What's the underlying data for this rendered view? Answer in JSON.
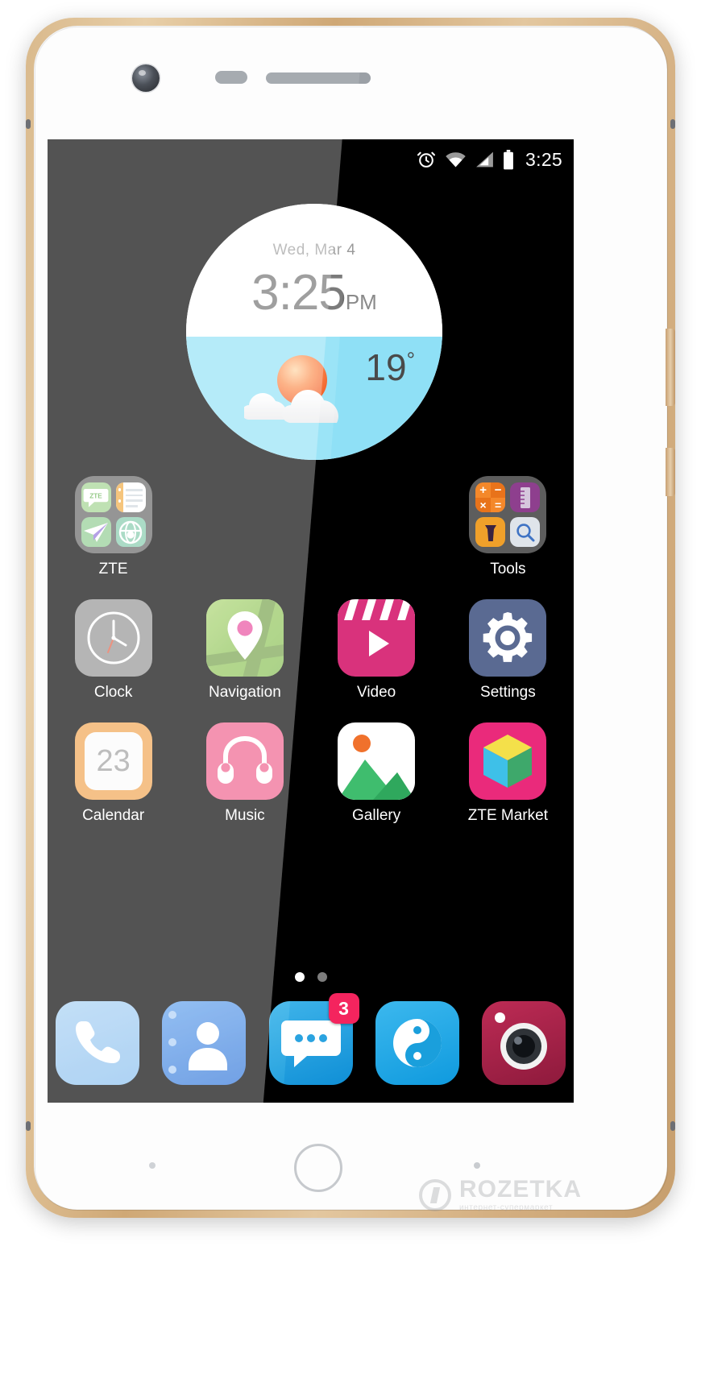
{
  "device": {
    "brand": "ZTE",
    "home_button": "home-button"
  },
  "status_bar": {
    "time": "3:25",
    "icons": [
      "alarm-icon",
      "wifi-icon",
      "signal-icon",
      "battery-icon"
    ]
  },
  "widget": {
    "name": "clock-weather-widget",
    "date": "Wed, Mar 4",
    "time": "3:25",
    "ampm": "PM",
    "temperature": "19",
    "degree": "°",
    "weather_icon": "sun-behind-cloud-icon",
    "refresh_icon": "refresh-icon",
    "sky_color": "#8fe0f6",
    "face_color": "#ffffff"
  },
  "home_screen": {
    "rows": [
      {
        "cells": [
          {
            "label": "ZTE",
            "type": "folder",
            "name": "folder-zte",
            "minis": [
              "zte-message-icon",
              "notes-icon",
              "paper-plane-icon",
              "browser-icon"
            ]
          },
          {
            "label": "",
            "type": "empty",
            "name": "empty-slot"
          },
          {
            "label": "",
            "type": "empty",
            "name": "empty-slot"
          },
          {
            "label": "Tools",
            "type": "folder",
            "name": "folder-tools",
            "minis": [
              "calculator-icon",
              "ruler-icon",
              "flashlight-icon",
              "search-icon"
            ]
          }
        ]
      },
      {
        "cells": [
          {
            "label": "Clock",
            "type": "app",
            "name": "app-clock",
            "icon": "clock-icon",
            "color": "#8c8c8c"
          },
          {
            "label": "Navigation",
            "type": "app",
            "name": "app-navigation",
            "icon": "map-pin-icon",
            "color": "#8dc63f"
          },
          {
            "label": "Video",
            "type": "app",
            "name": "app-video",
            "icon": "play-icon",
            "color": "#e0337f"
          },
          {
            "label": "Settings",
            "type": "app",
            "name": "app-settings",
            "icon": "gear-icon",
            "color": "#5a6a92"
          }
        ]
      },
      {
        "cells": [
          {
            "label": "Calendar",
            "type": "app",
            "name": "app-calendar",
            "icon": "calendar-icon",
            "color": "#f0a04b",
            "day": "23"
          },
          {
            "label": "Music",
            "type": "app",
            "name": "app-music",
            "icon": "earbuds-icon",
            "color": "#ef5b87"
          },
          {
            "label": "Gallery",
            "type": "app",
            "name": "app-gallery",
            "icon": "photo-icon",
            "color": "#ffffff"
          },
          {
            "label": "ZTE Market",
            "type": "app",
            "name": "app-zte-market",
            "icon": "cube-icon",
            "color": "#ea2a7b"
          }
        ]
      }
    ]
  },
  "page_indicator": {
    "total": 2,
    "active": 1
  },
  "dock": {
    "items": [
      {
        "name": "dock-phone",
        "icon": "phone-icon",
        "color": "#8ec2ef",
        "badge": ""
      },
      {
        "name": "dock-contacts",
        "icon": "contacts-icon",
        "color": "#2d7ae0",
        "badge": ""
      },
      {
        "name": "dock-messages",
        "icon": "message-icon",
        "color": "#1a9de0",
        "badge": "3"
      },
      {
        "name": "dock-browser",
        "icon": "globe-icon",
        "color": "#18a7e8",
        "badge": ""
      },
      {
        "name": "dock-camera",
        "icon": "camera-icon",
        "color": "#a51f48",
        "badge": ""
      }
    ]
  },
  "watermark": {
    "main": "ROZETKA",
    "sub": "интернет-супермаркет"
  }
}
